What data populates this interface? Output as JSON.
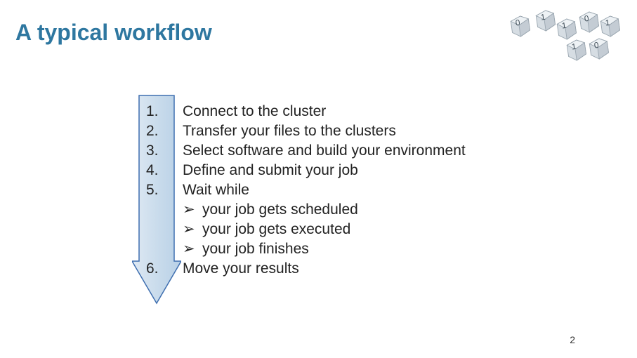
{
  "title": "A typical workflow",
  "steps": {
    "n1": "1.",
    "n2": "2.",
    "n3": "3.",
    "n4": "4.",
    "n5": "5.",
    "n6": "6.",
    "t1": "Connect to the cluster",
    "t2": "Transfer your files to the clusters",
    "t3": "Select software and build your environment",
    "t4": "Define and submit your job",
    "t5": "Wait while",
    "s1": "your job gets scheduled",
    "s2": "your job gets executed",
    "s3": "your job finishes",
    "t6": "Move your results"
  },
  "bullet": "➢",
  "logo": {
    "d1": "0",
    "d2": "1",
    "d3": "1",
    "d4": "0",
    "d5": "1",
    "d6": "1",
    "d7": "0"
  },
  "page": "2"
}
